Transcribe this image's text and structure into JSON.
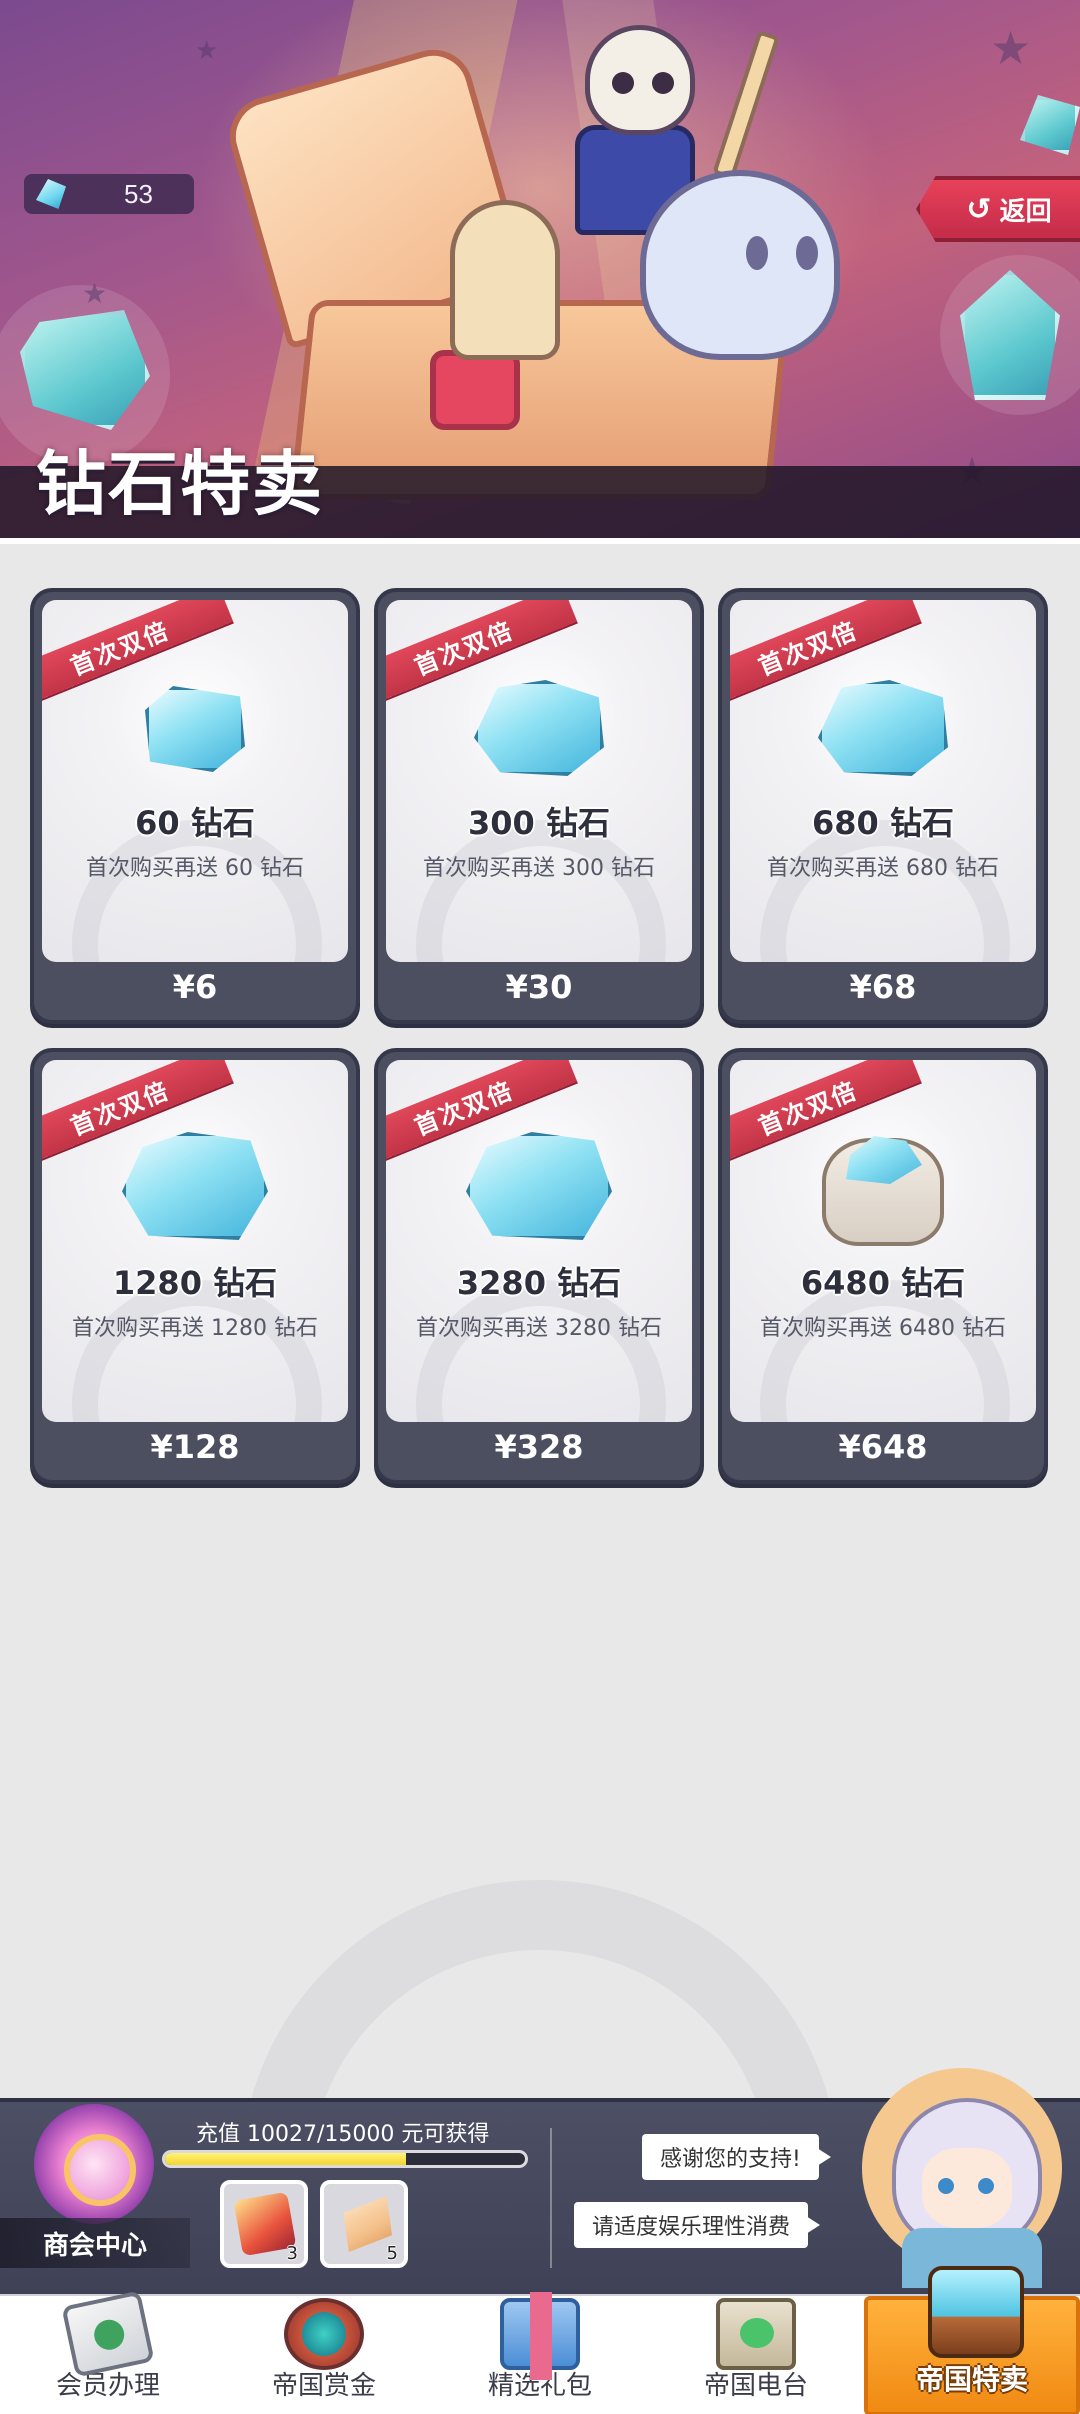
{
  "hero": {
    "title": "钻石特卖",
    "diamond_balance": "53",
    "back_label": "返回",
    "back_icon": "return-arrow-icon"
  },
  "products": [
    {
      "badge": "首次双倍",
      "amount": "60 钻石",
      "bonus": "首次购买再送 60 钻石",
      "price": "¥6",
      "icon": "diamond-small-icon"
    },
    {
      "badge": "首次双倍",
      "amount": "300 钻石",
      "bonus": "首次购买再送 300 钻石",
      "price": "¥30",
      "icon": "diamond-pile-icon"
    },
    {
      "badge": "首次双倍",
      "amount": "680 钻石",
      "bonus": "首次购买再送 680 钻石",
      "price": "¥68",
      "icon": "diamond-pile-icon"
    },
    {
      "badge": "首次双倍",
      "amount": "1280 钻石",
      "bonus": "首次购买再送 1280 钻石",
      "price": "¥128",
      "icon": "diamond-heap-icon"
    },
    {
      "badge": "首次双倍",
      "amount": "3280 钻石",
      "bonus": "首次购买再送 3280 钻石",
      "price": "¥328",
      "icon": "diamond-heap-icon"
    },
    {
      "badge": "首次双倍",
      "amount": "6480 钻石",
      "bonus": "首次购买再送 6480 钻石",
      "price": "¥648",
      "icon": "diamond-bag-icon"
    }
  ],
  "member": {
    "label": "商会中心",
    "recharge_text": "充值 10027/15000 元可获得",
    "progress_current": 10027,
    "progress_target": 15000,
    "rewards": [
      {
        "icon": "gift-box-icon",
        "count": "3"
      },
      {
        "icon": "ticket-icon",
        "count": "5"
      }
    ],
    "messages": [
      "感谢您的支持!",
      "请适度娱乐理性消费"
    ]
  },
  "bottom_nav": [
    {
      "label": "会员办理",
      "icon": "member-card-icon",
      "active": false
    },
    {
      "label": "帝国赏金",
      "icon": "bounty-emblem-icon",
      "active": false
    },
    {
      "label": "精选礼包",
      "icon": "gift-pack-icon",
      "active": false
    },
    {
      "label": "帝国电台",
      "icon": "radio-scroll-icon",
      "active": false
    },
    {
      "label": "帝国特卖",
      "icon": "treasure-chest-icon",
      "active": true
    }
  ],
  "colors": {
    "page_background": "#e8e8e9",
    "card_frame": "#4b4f60",
    "ribbon_red": "#c23447",
    "progress_yellow": "#f2d52e",
    "active_tab_orange": "#f08a12",
    "back_button_red": "#c42c49"
  }
}
